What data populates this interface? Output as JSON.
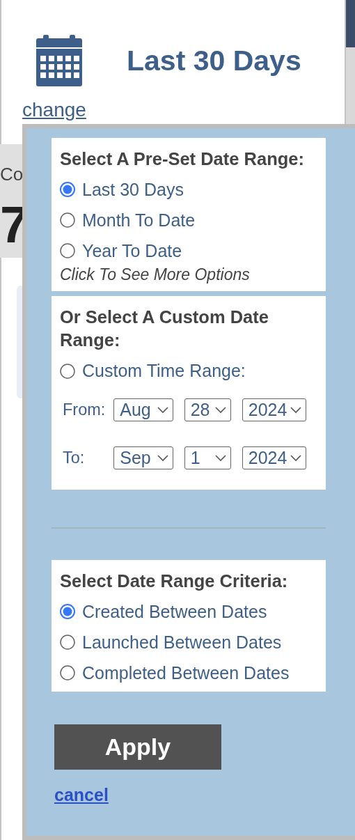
{
  "header": {
    "title": "Last 30 Days",
    "change_link": "change"
  },
  "background": {
    "label": "Co",
    "value": "7"
  },
  "popup": {
    "preset": {
      "heading": "Select A Pre-Set Date Range:",
      "options": [
        {
          "label": "Last 30 Days",
          "selected": true
        },
        {
          "label": "Month To Date",
          "selected": false
        },
        {
          "label": "Year To Date",
          "selected": false
        }
      ],
      "more_link": "Click To See More Options"
    },
    "custom": {
      "heading": "Or Select A Custom Date Range:",
      "option": {
        "label": "Custom Time Range:",
        "selected": false
      },
      "rows": [
        {
          "label": "From:",
          "month": "Aug",
          "day": "28",
          "year": "2024"
        },
        {
          "label": "To:",
          "month": "Sep",
          "day": "1",
          "year": "2024"
        }
      ]
    },
    "criteria": {
      "heading": "Select Date Range Criteria:",
      "options": [
        {
          "label": "Created Between Dates",
          "selected": true
        },
        {
          "label": "Launched Between Dates",
          "selected": false
        },
        {
          "label": "Completed Between Dates",
          "selected": false
        }
      ]
    },
    "apply_button": "Apply",
    "cancel_link": "cancel"
  }
}
